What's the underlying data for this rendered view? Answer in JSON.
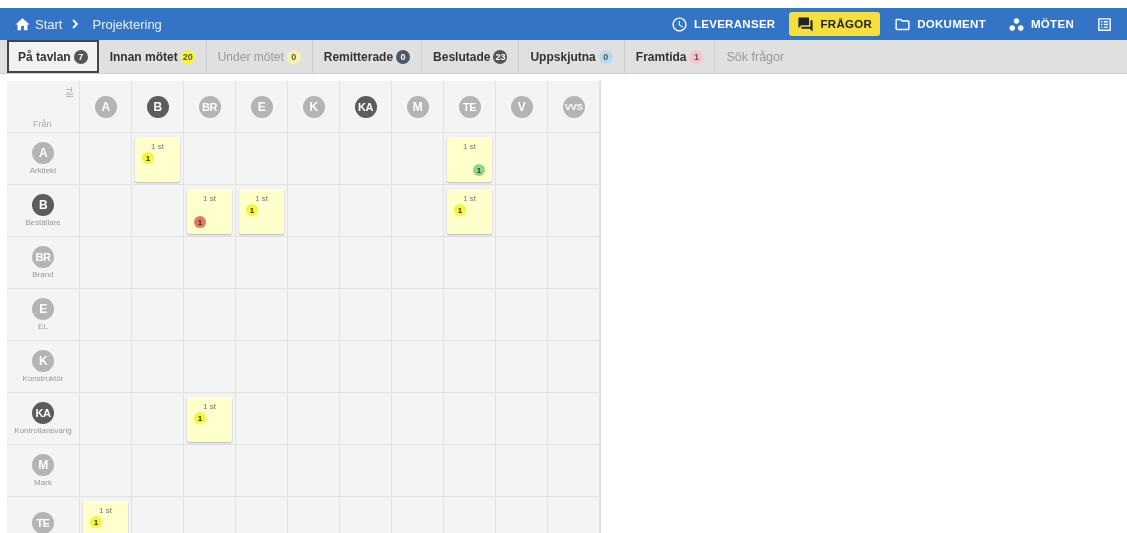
{
  "breadcrumb": [
    {
      "label": "Start",
      "kind": "home"
    },
    {
      "label": "Projektering",
      "kind": "page"
    }
  ],
  "nav": [
    {
      "label": "LEVERANSER",
      "selected": false
    },
    {
      "label": "FRÅGOR",
      "selected": true
    },
    {
      "label": "DOKUMENT",
      "selected": false
    },
    {
      "label": "MÖTEN",
      "selected": false
    },
    {
      "selected": false
    }
  ],
  "tabs": [
    {
      "label": "På tavlan",
      "count": "7",
      "color": "#555555",
      "selected": true,
      "disabled": false
    },
    {
      "label": "Innan mötet",
      "count": "20",
      "color": "#f5f53a",
      "selected": false,
      "disabled": false
    },
    {
      "label": "Under mötet",
      "count": "0",
      "color": "#f7f3a8",
      "selected": false,
      "disabled": true
    },
    {
      "label": "Remitterade",
      "count": "0",
      "color": "#4f5668",
      "selected": false,
      "disabled": false
    },
    {
      "label": "Beslutade",
      "count": "23",
      "color": "#555555",
      "selected": false,
      "disabled": false
    },
    {
      "label": "Uppskjutna",
      "count": "0",
      "color": "#b9dcec",
      "selected": false,
      "disabled": false
    },
    {
      "label": "Framtida",
      "count": "1",
      "color": "#f6c6cf",
      "selected": false,
      "disabled": false
    }
  ],
  "search": {
    "placeholder": "Sök frågor"
  },
  "grid": {
    "to_label": "Till",
    "from_label": "Från",
    "columns": [
      {
        "initials": "A",
        "active": false
      },
      {
        "initials": "B",
        "active": true
      },
      {
        "initials": "BR",
        "active": false
      },
      {
        "initials": "E",
        "active": false
      },
      {
        "initials": "K",
        "active": false
      },
      {
        "initials": "KA",
        "active": true
      },
      {
        "initials": "M",
        "active": false
      },
      {
        "initials": "TE",
        "active": false
      },
      {
        "initials": "V",
        "active": false
      },
      {
        "initials": "VVS",
        "active": false
      }
    ],
    "rows": [
      {
        "initials": "A",
        "label": "Arkitekt",
        "active": false,
        "cells": [
          null,
          {
            "count": "1 st",
            "badge": {
              "text": "1",
              "color": "#f5f53a",
              "kind": "top"
            }
          },
          null,
          null,
          null,
          null,
          null,
          {
            "count": "1 st",
            "badge": {
              "text": "1",
              "color": "#8fd68f",
              "kind": "corner-right"
            }
          },
          null,
          null
        ]
      },
      {
        "initials": "B",
        "label": "Beställare",
        "active": true,
        "cells": [
          null,
          null,
          {
            "count": "1 st",
            "badge": {
              "text": "1",
              "color": "#e8775a",
              "kind": "corner-left"
            }
          },
          {
            "count": "1 st",
            "badge": {
              "text": "1",
              "color": "#f5f53a",
              "kind": "top"
            }
          },
          null,
          null,
          null,
          {
            "count": "1 st",
            "badge": {
              "text": "1",
              "color": "#f5f53a",
              "kind": "top"
            }
          },
          null,
          null
        ]
      },
      {
        "initials": "BR",
        "label": "Brand",
        "active": false,
        "cells": [
          null,
          null,
          null,
          null,
          null,
          null,
          null,
          null,
          null,
          null
        ]
      },
      {
        "initials": "E",
        "label": "EL",
        "active": false,
        "cells": [
          null,
          null,
          null,
          null,
          null,
          null,
          null,
          null,
          null,
          null
        ]
      },
      {
        "initials": "K",
        "label": "Konstruktör",
        "active": false,
        "cells": [
          null,
          null,
          null,
          null,
          null,
          null,
          null,
          null,
          null,
          null
        ]
      },
      {
        "initials": "KA",
        "label": "Kontrollansvarig",
        "active": true,
        "cells": [
          null,
          null,
          {
            "count": "1 st",
            "badge": {
              "text": "1",
              "color": "#f5f53a",
              "kind": "top"
            }
          },
          null,
          null,
          null,
          null,
          null,
          null,
          null
        ]
      },
      {
        "initials": "M",
        "label": "Mark",
        "active": false,
        "cells": [
          null,
          null,
          null,
          null,
          null,
          null,
          null,
          null,
          null,
          null
        ]
      },
      {
        "initials": "TE",
        "active": false,
        "cells": [
          {
            "count": "1 st",
            "badge": {
              "text": "1",
              "color": "#f5f53a",
              "kind": "top"
            }
          },
          null,
          null,
          null,
          null,
          null,
          null,
          null,
          null,
          null
        ]
      }
    ]
  }
}
